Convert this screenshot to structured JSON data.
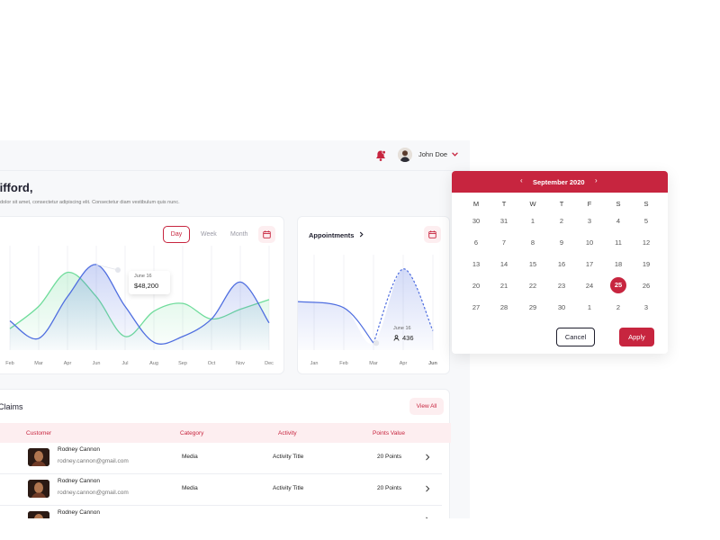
{
  "header": {
    "user_name": "John Doe"
  },
  "greeting": {
    "title": "lifford,",
    "subtitle": "dolor sit amet, consectetur adipiscing elit. Consectetur diam vestibulum quis nunc."
  },
  "range_tabs": [
    "Day",
    "Week",
    "Month"
  ],
  "main_chart": {
    "tooltip": {
      "date": "June 16",
      "value": "$48,200"
    }
  },
  "appointments": {
    "title": "Appointments",
    "tooltip": {
      "date": "June 16",
      "value": "436"
    }
  },
  "claims": {
    "title": "y Claims",
    "view_all": "View All",
    "columns": [
      "Customer",
      "Category",
      "Activity",
      "Points Value"
    ],
    "rows": [
      {
        "name": "Rodney Cannon",
        "email": "rodney.cannon@gmail.com",
        "category": "Media",
        "activity": "Activity Title",
        "points": "20 Points"
      },
      {
        "name": "Rodney Cannon",
        "email": "rodney.cannon@gmail.com",
        "category": "Media",
        "activity": "Activity Title",
        "points": "20 Points"
      },
      {
        "name": "Rodney Cannon",
        "email": "",
        "category": "",
        "activity": "",
        "points": ""
      }
    ]
  },
  "calendar": {
    "month_label": "September 2020",
    "weekdays": [
      "M",
      "T",
      "W",
      "T",
      "F",
      "S",
      "S"
    ],
    "weeks": [
      [
        "30",
        "31",
        "1",
        "2",
        "3",
        "4",
        "5"
      ],
      [
        "6",
        "7",
        "8",
        "9",
        "10",
        "11",
        "12"
      ],
      [
        "13",
        "14",
        "15",
        "16",
        "17",
        "18",
        "19"
      ],
      [
        "20",
        "21",
        "22",
        "23",
        "24",
        "25",
        "26"
      ],
      [
        "27",
        "28",
        "29",
        "30",
        "1",
        "2",
        "3"
      ]
    ],
    "selected_day": "25",
    "cancel_label": "Cancel",
    "apply_label": "Apply"
  },
  "colors": {
    "accent": "#c7253f",
    "accent_soft": "#fdeef0",
    "blue_series": "#4f6ee0",
    "green_series": "#6fdc9b"
  },
  "chart_data": [
    {
      "type": "line",
      "categories": [
        "Feb",
        "Mar",
        "Apr",
        "Jun",
        "Jul",
        "Aug",
        "Sep",
        "Oct",
        "Nov",
        "Dec"
      ],
      "highlight_category": "Jun",
      "series": [
        {
          "color": "#4f6ee0",
          "values": [
            30,
            12,
            55,
            88,
            45,
            8,
            14,
            32,
            70,
            28
          ]
        },
        {
          "color": "#6fdc9b",
          "values": [
            22,
            45,
            80,
            55,
            14,
            40,
            48,
            32,
            42,
            52
          ]
        }
      ],
      "ylim": [
        0,
        100
      ],
      "grid": true,
      "annotation": {
        "category": "Jun",
        "label": "June 16",
        "value": "$48,200"
      }
    },
    {
      "type": "line",
      "categories": [
        "Jan",
        "Feb",
        "Mar",
        "Apr",
        "Jun"
      ],
      "highlight_category": "Jun",
      "series": [
        {
          "color": "#4f6ee0",
          "values": [
            55,
            48,
            8,
            92,
            22
          ],
          "dashed_from_index": 2
        }
      ],
      "ylim": [
        0,
        100
      ],
      "grid": true,
      "annotation": {
        "category": "Mar",
        "label": "June 16",
        "value": "436"
      }
    }
  ]
}
